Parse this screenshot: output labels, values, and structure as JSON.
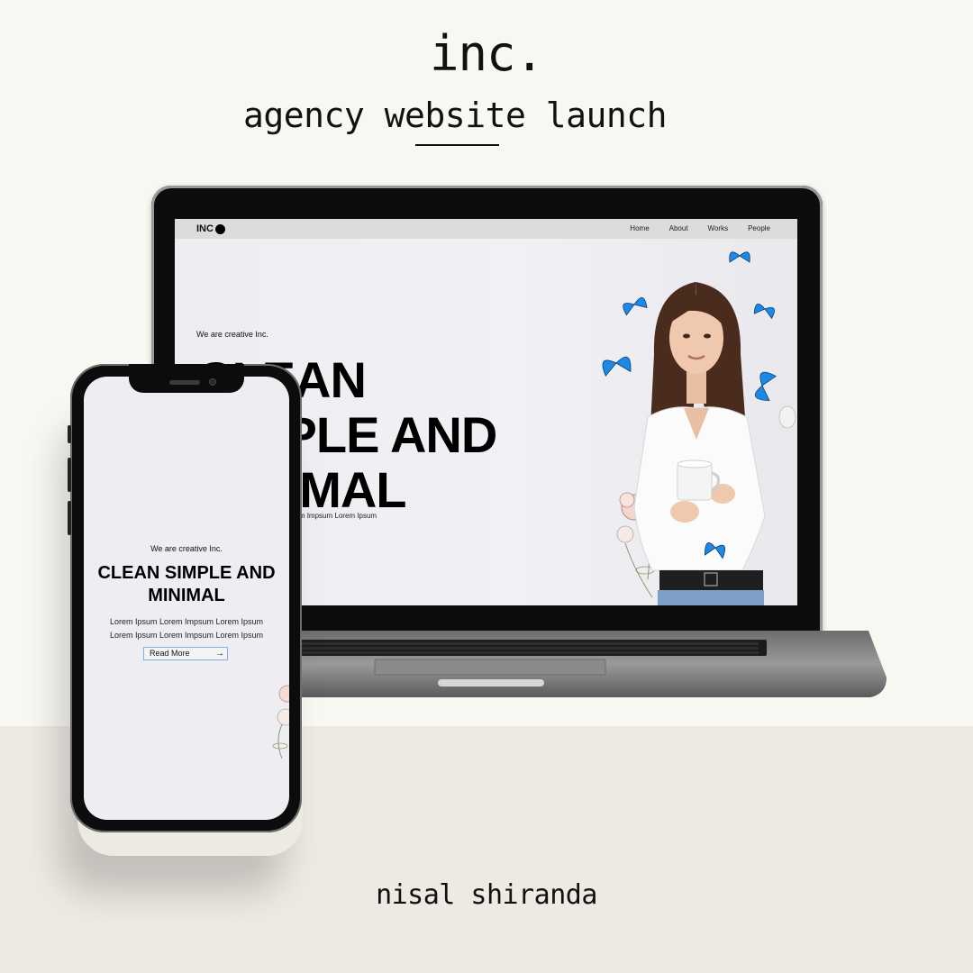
{
  "poster": {
    "brand": "inc.",
    "headline": "agency website launch",
    "author": "nisal shiranda"
  },
  "laptop_site": {
    "logo_text": "INC",
    "nav": [
      "Home",
      "About",
      "Works",
      "People"
    ],
    "tagline": "We are creative Inc.",
    "heading_line1": "CLEAN",
    "heading_line2": "SIMPLE AND",
    "heading_line3": "MINIMAL",
    "body": "Lorem Ipsum Lorem Ipsum Lorem Impsum Lorem Ipsum"
  },
  "mobile_site": {
    "tagline": "We are creative Inc.",
    "heading_line1": "CLEAN SIMPLE AND",
    "heading_line2": "MINIMAL",
    "body_line1": "Lorem Ipsum Lorem Impsum Lorem Ipsum",
    "body_line2": "Lorem Ipsum Lorem Impsum Lorem Ipsum",
    "button_label": "Read More",
    "button_icon": "arrow-right-icon"
  },
  "colors": {
    "page_background": "#f8f7f2",
    "bottom_band": "#ede9e3",
    "butterfly_blue": "#1e88e5",
    "button_border": "#7fb0e0"
  }
}
